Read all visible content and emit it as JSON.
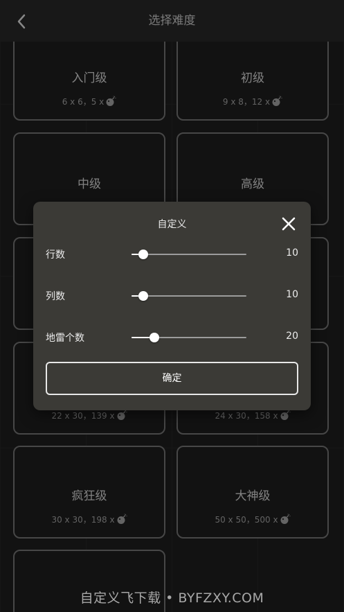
{
  "header": {
    "title": "选择难度"
  },
  "levels": [
    {
      "name": "入门级",
      "spec": "6 x 6，5 x"
    },
    {
      "name": "初级",
      "spec": "9 x 8，12 x"
    },
    {
      "name": "中级",
      "spec": ""
    },
    {
      "name": "高级",
      "spec": ""
    },
    {
      "name": "",
      "spec": ""
    },
    {
      "name": "",
      "spec": ""
    },
    {
      "name": "",
      "spec": "22 x 30，139 x"
    },
    {
      "name": "",
      "spec": "24 x 30，158 x"
    },
    {
      "name": "疯狂级",
      "spec": "30 x 30，198 x"
    },
    {
      "name": "大神级",
      "spec": "50 x 50，500 x"
    },
    {
      "name": "",
      "spec": ""
    }
  ],
  "dialog": {
    "title": "自定义",
    "rows": [
      {
        "label": "行数",
        "value": "10",
        "level": 0.1
      },
      {
        "label": "列数",
        "value": "10",
        "level": 0.1
      },
      {
        "label": "地雷个数",
        "value": "20",
        "level": 0.2
      }
    ],
    "confirm_label": "确定"
  },
  "watermark": "自定义飞下载 • BYFZXY.COM",
  "icons": {
    "back": "chevron-left-icon",
    "close": "close-icon",
    "bomb": "bomb-icon"
  },
  "colors": {
    "background": "#1c1c1c",
    "card_border": "#6e6e6e",
    "dialog_bg": "#3b3a36",
    "slider_active": "#ffffff"
  }
}
